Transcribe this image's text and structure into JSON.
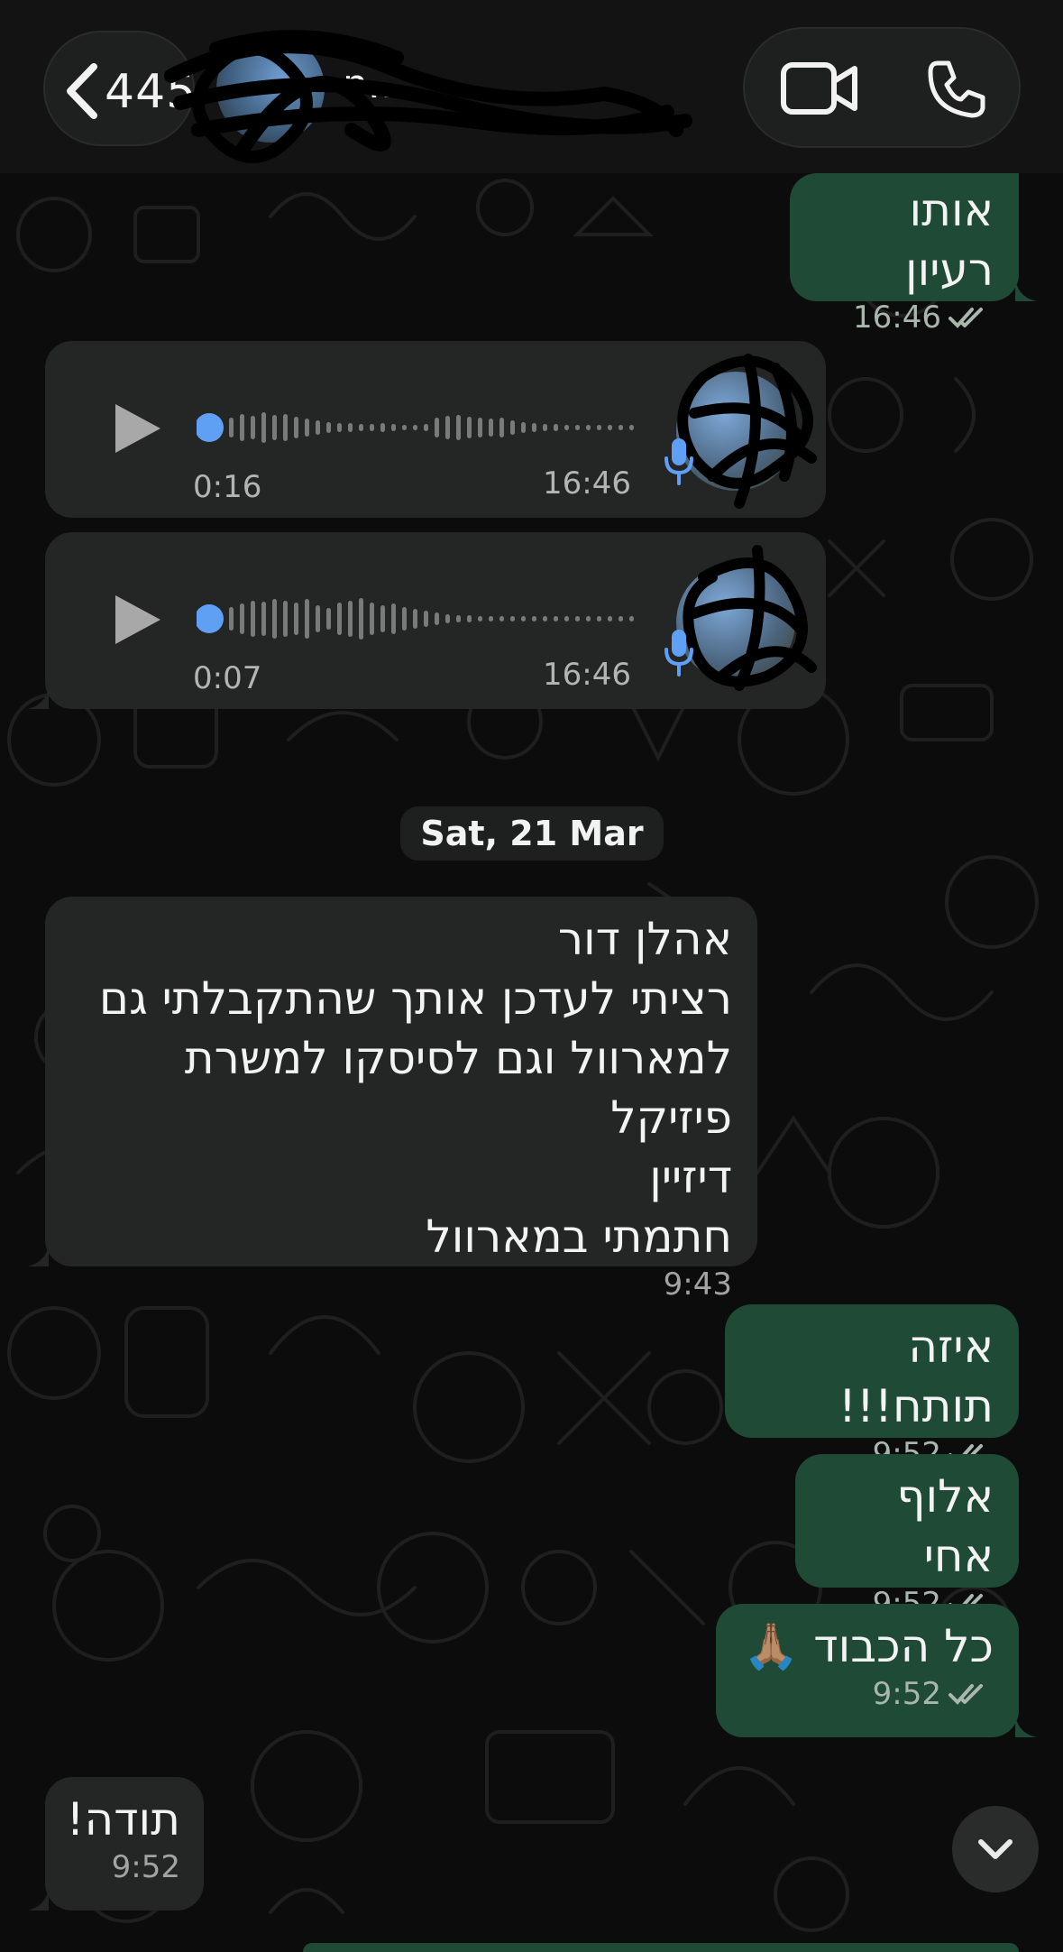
{
  "header": {
    "back_count": "445",
    "contact_name": "...  ..n",
    "icons": [
      "chevron-left-icon",
      "video-camera-icon",
      "phone-icon"
    ]
  },
  "messages": [
    {
      "direction": "out",
      "text": "אותו רעיון",
      "time": "16:46",
      "status": "read"
    },
    {
      "direction": "in",
      "type": "voice",
      "duration": "0:16",
      "time": "16:46"
    },
    {
      "direction": "in",
      "type": "voice",
      "duration": "0:07",
      "time": "16:46"
    },
    {
      "direction": "in",
      "text": "אהלן דור\nרציתי לעדכן אותך שהתקבלתי גם\nלמארוול וגם לסיסקו למשרת פיזיקל\nדיזיין\nחתמתי במארוול",
      "time": "9:43"
    },
    {
      "direction": "out",
      "text": "איזה תותח!!!",
      "time": "9:52",
      "status": "read"
    },
    {
      "direction": "out",
      "text": "אלוף אחי",
      "time": "9:52",
      "status": "read"
    },
    {
      "direction": "out",
      "text": "כל הכבוד 🙏🏽",
      "time": "9:52",
      "status": "read"
    },
    {
      "direction": "in",
      "text": "תודה!",
      "time": "9:52"
    }
  ],
  "date_separator": "Sat, 21 Mar",
  "colors": {
    "outgoing_bubble": "#1f4a35",
    "incoming_bubble": "#242525",
    "voice_accent": "#5fa0f5",
    "background": "#0c0c0c"
  }
}
